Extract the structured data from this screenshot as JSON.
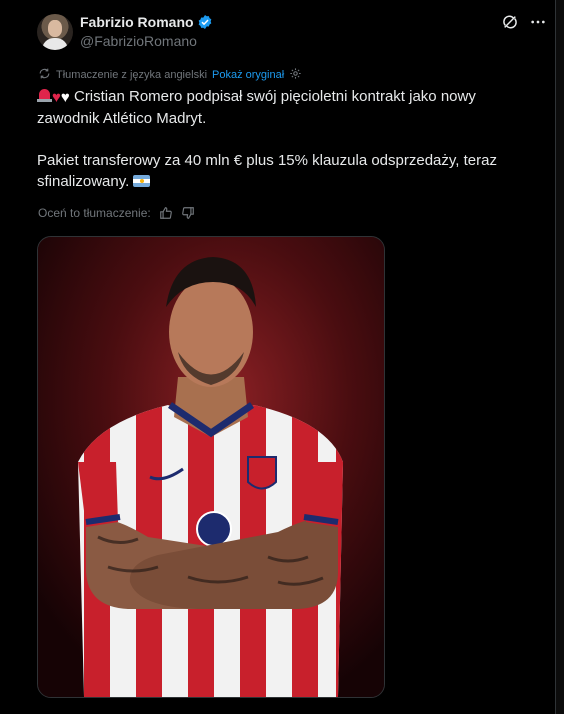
{
  "author": {
    "display_name": "Fabrizio Romano",
    "handle": "@FabrizioRomano",
    "verified_color": "#1d9bf0"
  },
  "header_icons": [
    "grok-icon",
    "more-options-icon"
  ],
  "translation": {
    "label": "Tłumaczenie z języka angielski",
    "show_original": "Pokaż oryginał"
  },
  "tweet": {
    "line1": "Cristian Romero podpisał swój pięcioletni kontrakt jako nowy zawodnik Atlético Madryt.",
    "line2": "Pakiet transferowy za 40 mln € plus 15% klauzula odsprzedaży, teraz sfinalizowany."
  },
  "rating": {
    "label": "Oceń to tłumaczenie:"
  },
  "media": {
    "kind": "photo",
    "subject": "player in red-and-white striped kit, arms crossed",
    "colors": {
      "background": "#4a0d10",
      "stripe_red": "#c8202c",
      "stripe_white": "#f2f2f2",
      "collar": "#1d2b6e"
    }
  },
  "colors": {
    "background": "#000000",
    "text": "#e7e9ea",
    "muted": "#71767b",
    "link": "#1d9bf0"
  }
}
